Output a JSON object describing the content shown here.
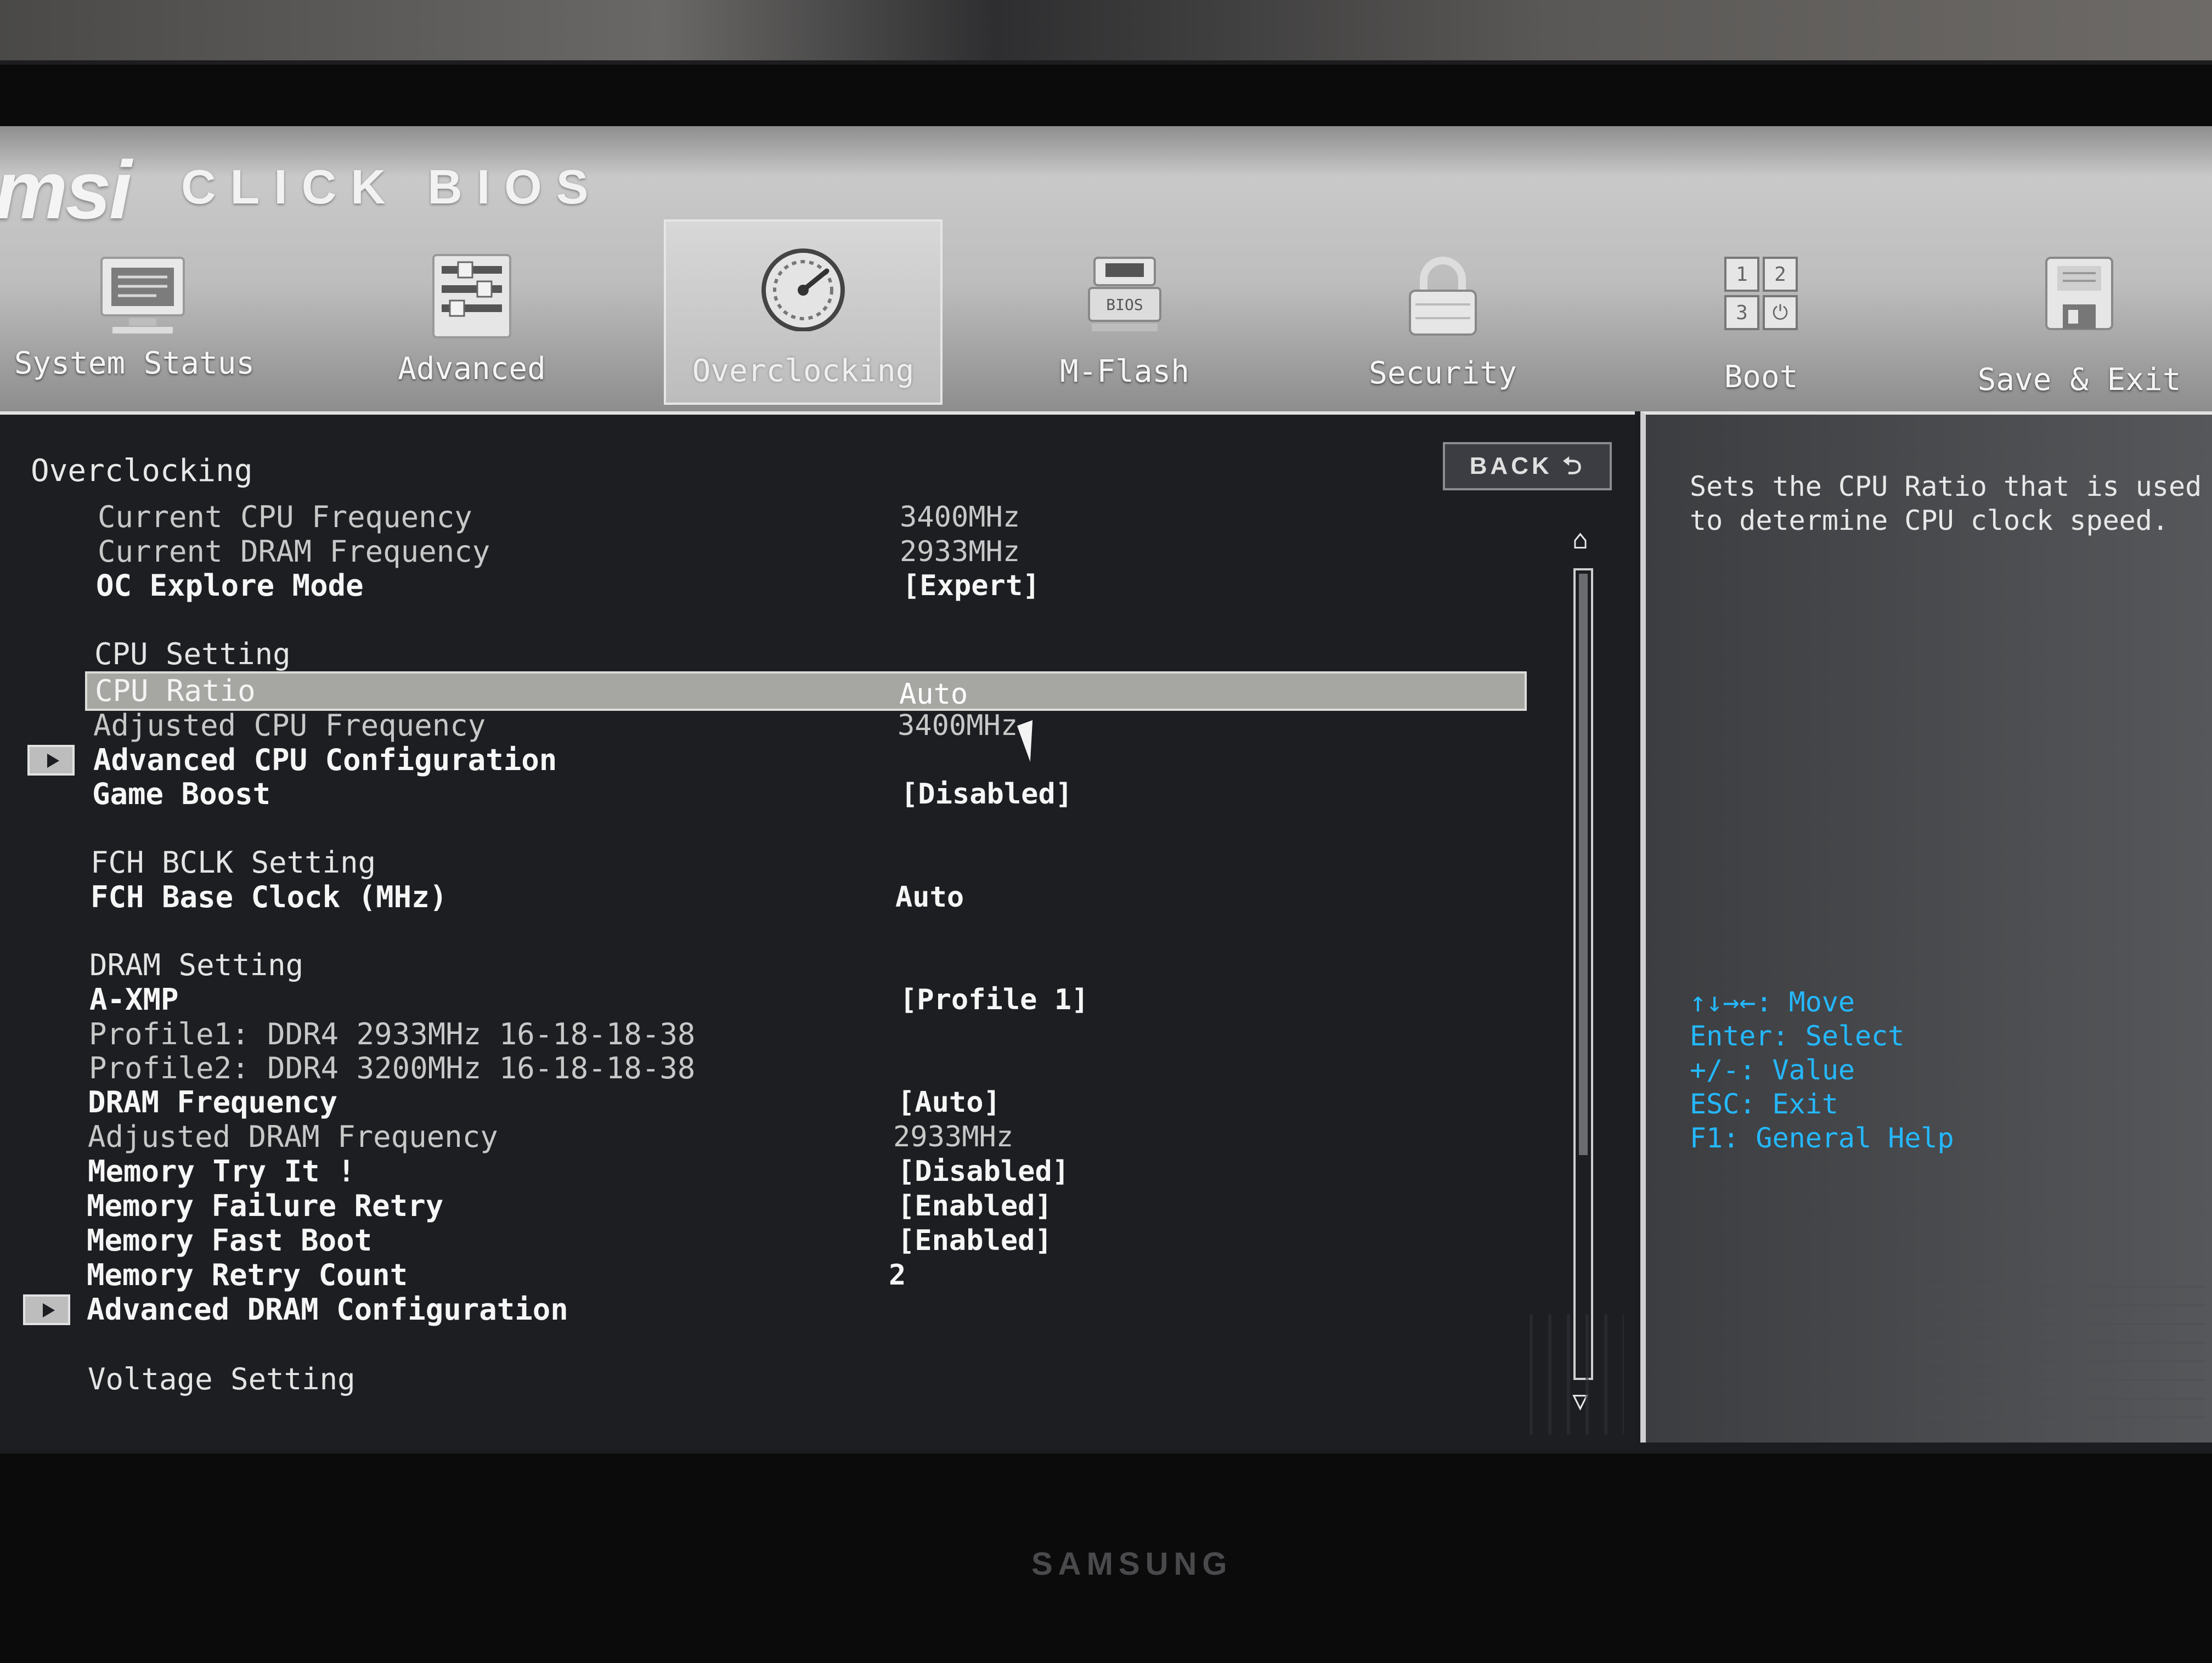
{
  "monitor": {
    "brand": "SAMSUNG"
  },
  "header": {
    "logo": "msi",
    "product": "CLICK BIOS",
    "tabs": [
      {
        "label": "System Status",
        "icon": "monitor-icon"
      },
      {
        "label": "Advanced",
        "icon": "sliders-icon"
      },
      {
        "label": "Overclocking",
        "icon": "speedometer-icon",
        "active": true
      },
      {
        "label": "M-Flash",
        "icon": "bios-chip-icon",
        "badge": "BIOS"
      },
      {
        "label": "Security",
        "icon": "padlock-icon"
      },
      {
        "label": "Boot",
        "icon": "boot-grid-icon",
        "grid": [
          "1",
          "2",
          "3",
          "⏻"
        ]
      },
      {
        "label": "Save & Exit",
        "icon": "floppy-icon"
      }
    ]
  },
  "main": {
    "section_title": "Overclocking",
    "back_label": "BACK ⮌",
    "rows": [
      {
        "label": "Current CPU Frequency",
        "value": "3400MHz"
      },
      {
        "label": "Current DRAM Frequency",
        "value": "2933MHz"
      },
      {
        "label": "OC Explore Mode",
        "value": "[Expert]"
      },
      {
        "label": "CPU Setting",
        "value": ""
      },
      {
        "label": "CPU Ratio",
        "value": "Auto"
      },
      {
        "label": "Adjusted CPU Frequency",
        "value": "3400MHz"
      },
      {
        "label": "Advanced CPU Configuration",
        "value": ""
      },
      {
        "label": "Game Boost",
        "value": "[Disabled]"
      },
      {
        "label": "FCH BCLK Setting",
        "value": ""
      },
      {
        "label": "FCH Base Clock (MHz)",
        "value": "Auto"
      },
      {
        "label": "DRAM Setting",
        "value": ""
      },
      {
        "label": "A-XMP",
        "value": "[Profile 1]"
      },
      {
        "label": "Profile1: DDR4 2933MHz 16-18-18-38",
        "value": ""
      },
      {
        "label": "Profile2: DDR4 3200MHz 16-18-18-38",
        "value": ""
      },
      {
        "label": "DRAM Frequency",
        "value": "[Auto]"
      },
      {
        "label": "Adjusted DRAM Frequency",
        "value": "2933MHz"
      },
      {
        "label": "Memory Try It !",
        "value": "[Disabled]"
      },
      {
        "label": "Memory Failure Retry",
        "value": "[Enabled]"
      },
      {
        "label": "Memory Fast Boot",
        "value": "[Enabled]"
      },
      {
        "label": "Memory Retry Count",
        "value": "2"
      },
      {
        "label": "Advanced DRAM Configuration",
        "value": ""
      },
      {
        "label": "Voltage Setting",
        "value": ""
      }
    ],
    "scroll_up": "⌂",
    "scroll_down": "▽"
  },
  "help": {
    "description": "Sets the CPU Ratio that is used to determine CPU clock speed.",
    "keys": [
      "↑↓→←: Move",
      "Enter: Select",
      "+/-: Value",
      "ESC: Exit",
      "F1: General Help"
    ]
  },
  "colors": {
    "accent_keys": "#25b8ff",
    "selected_row": "#a6a6a2",
    "panel_bg": "#1c1e22",
    "header_silver": "#c9c9c9"
  }
}
